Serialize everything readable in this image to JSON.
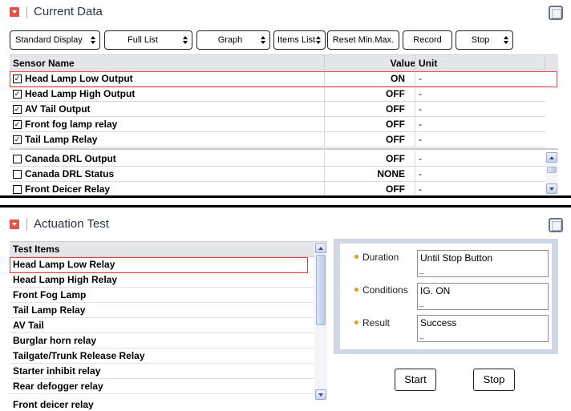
{
  "current_data": {
    "title": "Current Data",
    "toolbar": {
      "display_mode": "Standard Display",
      "list_mode": "Full List",
      "graph": "Graph",
      "items_list": "Items List",
      "reset": "Reset Min.Max.",
      "record": "Record",
      "stop": "Stop"
    },
    "columns": {
      "name": "Sensor Name",
      "value": "Value",
      "unit": "Unit"
    },
    "selected_rows": [
      {
        "name": "Head Lamp Low Output",
        "value": "ON",
        "unit": "-",
        "checked": true
      },
      {
        "name": "Head Lamp High Output",
        "value": "OFF",
        "unit": "-",
        "checked": true
      },
      {
        "name": "AV Tail Output",
        "value": "OFF",
        "unit": "-",
        "checked": true
      },
      {
        "name": "Front fog lamp relay",
        "value": "OFF",
        "unit": "-",
        "checked": true
      },
      {
        "name": "Tail Lamp Relay",
        "value": "OFF",
        "unit": "-",
        "checked": true
      }
    ],
    "other_rows": [
      {
        "name": "Canada DRL Output",
        "value": "OFF",
        "unit": "-",
        "checked": false
      },
      {
        "name": "Canada DRL Status",
        "value": "NONE",
        "unit": "-",
        "checked": false
      },
      {
        "name": "Front Deicer Relay",
        "value": "OFF",
        "unit": "-",
        "checked": false
      }
    ]
  },
  "actuation_test": {
    "title": "Actuation Test",
    "list_header": "Test Items",
    "items": [
      "Head Lamp Low Relay",
      "Head Lamp High Relay",
      "Front Fog Lamp",
      "Tail Lamp Relay",
      "AV Tail",
      "Burglar horn relay",
      "Tailgate/Trunk Release Relay",
      "Starter inhibit relay",
      "Rear defogger relay",
      "Front deicer relay"
    ],
    "details": {
      "duration_label": "Duration",
      "duration_value": "Until Stop Button",
      "conditions_label": "Conditions",
      "conditions_value": "IG. ON",
      "result_label": "Result",
      "result_value": "Success"
    },
    "start_label": "Start",
    "stop_label": "Stop"
  }
}
